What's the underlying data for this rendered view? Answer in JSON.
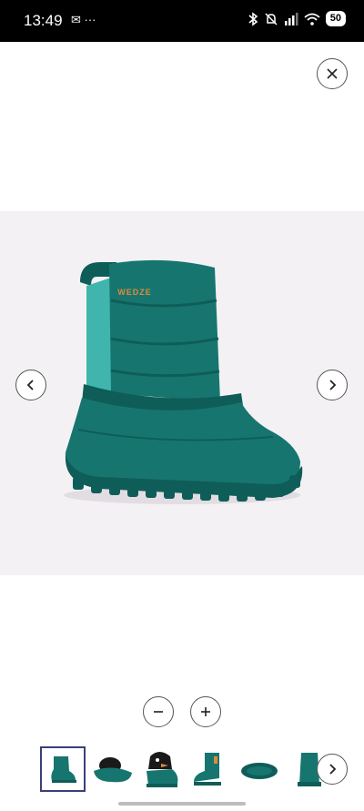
{
  "status_bar": {
    "time": "13:49",
    "left_icons": [
      "whatsapp-icon",
      "more-dots-icon"
    ],
    "left_icons_text": "✉ ···",
    "right_icons": [
      "bluetooth-icon",
      "mute-icon",
      "signal-icon",
      "wifi-icon"
    ],
    "battery": "50"
  },
  "product": {
    "brand_label": "WEDZE",
    "image": "snow-boot-teal"
  },
  "colors": {
    "boot_main": "#16766f",
    "boot_dark": "#0f5d58",
    "boot_accent": "#3fb5ad",
    "label_orange": "#e08a3a",
    "image_bg": "#f4f1f4"
  },
  "thumbnails": [
    {
      "name": "boot-side",
      "selected": true
    },
    {
      "name": "boot-top",
      "selected": false
    },
    {
      "name": "boot-penguin",
      "selected": false
    },
    {
      "name": "boot-back",
      "selected": false
    },
    {
      "name": "boot-sole",
      "selected": false
    },
    {
      "name": "boot-front",
      "selected": false
    }
  ]
}
